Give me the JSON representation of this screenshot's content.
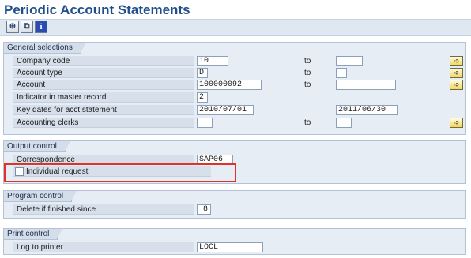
{
  "page": {
    "title": "Periodic Account Statements"
  },
  "toolbar": {
    "execute_icon": "execute-icon",
    "variant_icon": "get-variant-icon",
    "info_icon": "info-icon",
    "info_glyph": "i"
  },
  "general": {
    "header": "General selections",
    "to_label": "to",
    "company_code": {
      "label": "Company code",
      "value": "10"
    },
    "account_type": {
      "label": "Account type",
      "value": "D"
    },
    "account": {
      "label": "Account",
      "value": "100000092"
    },
    "indicator": {
      "label": "Indicator in master record",
      "value": "2"
    },
    "key_dates": {
      "label": "Key dates for acct statement",
      "from": "2010/07/01",
      "to": "2011/06/30"
    },
    "clerks": {
      "label": "Accounting clerks",
      "value": ""
    }
  },
  "output": {
    "header": "Output control",
    "correspondence": {
      "label": "Correspondence",
      "value": "SAP06"
    },
    "individual_request": {
      "label": "Individual request",
      "checked": false
    }
  },
  "program": {
    "header": "Program control",
    "delete_since": {
      "label": "Delete if finished since",
      "value": "8"
    }
  },
  "print": {
    "header": "Print control",
    "log_printer": {
      "label": "Log to printer",
      "value": "LOCL"
    }
  },
  "colors": {
    "title": "#1f4f8a",
    "highlight": "#e0322b",
    "section_bg": "#e7edf5"
  }
}
